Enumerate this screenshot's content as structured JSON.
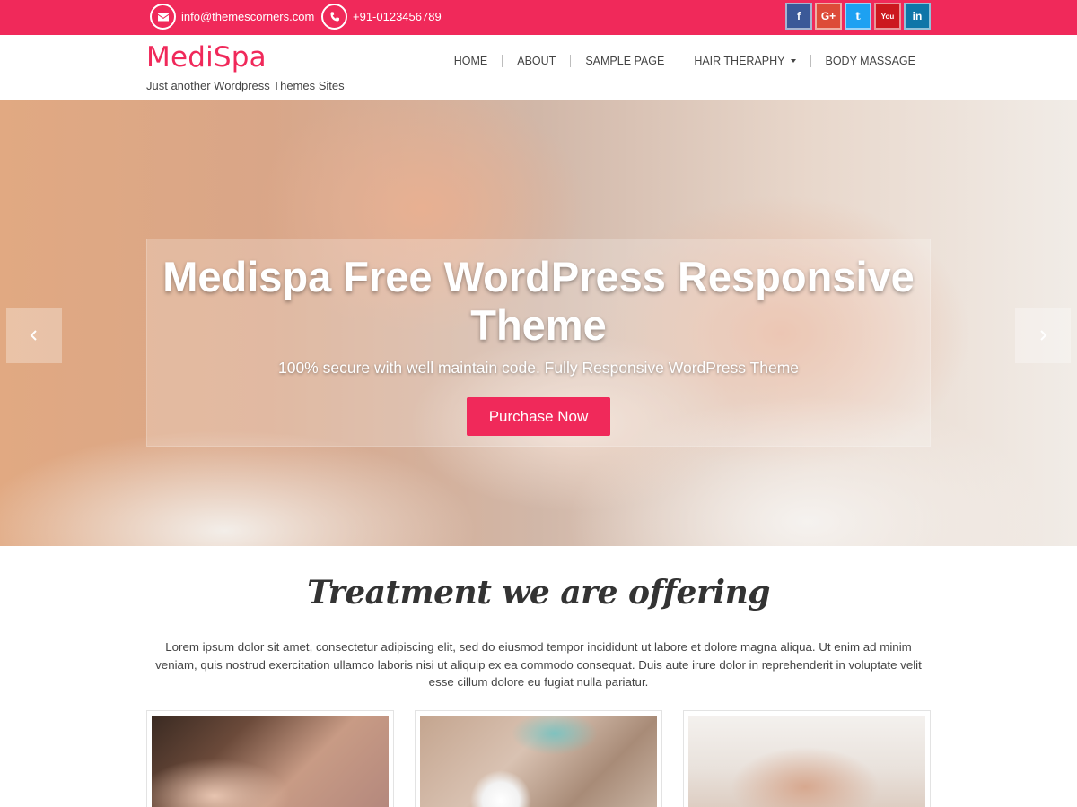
{
  "topbar": {
    "email": "info@themescorners.com",
    "phone": "+91-0123456789",
    "email_icon": "envelope-icon",
    "phone_icon": "phone-icon",
    "socials": [
      {
        "name": "facebook",
        "glyph": "f",
        "color": "#3b5998"
      },
      {
        "name": "google-plus",
        "glyph": "G+",
        "color": "#dd4b39"
      },
      {
        "name": "twitter",
        "glyph": "t",
        "color": "#1da1f2"
      },
      {
        "name": "youtube",
        "glyph": "You",
        "color": "#cc181e"
      },
      {
        "name": "linkedin",
        "glyph": "in",
        "color": "#0e76a8"
      }
    ],
    "background": "#f0295a"
  },
  "header": {
    "site_title": "MediSpa",
    "tagline": "Just another Wordpress Themes Sites",
    "nav": [
      "HOME",
      "ABOUT",
      "SAMPLE PAGE",
      "HAIR THERAPHY",
      "BODY MASSAGE"
    ]
  },
  "hero": {
    "title": "Medispa Free WordPress Responsive Theme",
    "subtitle": "100% secure with well maintain code. Fully Responsive WordPress Theme",
    "button": "Purchase Now",
    "prev_icon": "chevron-left-icon",
    "next_icon": "chevron-right-icon"
  },
  "treatments": {
    "title": "Treatment we are offering",
    "text": "Lorem ipsum dolor sit amet, consectetur adipiscing elit, sed do eiusmod tempor incididunt ut labore et dolore magna aliqua. Ut enim ad minim veniam, quis nostrud exercitation ullamco laboris nisi ut aliquip ex ea commodo consequat. Duis aute irure dolor in reprehenderit in voluptate velit esse cillum dolore eu fugiat nulla pariatur."
  },
  "colors": {
    "accent": "#f0295a",
    "text": "#444444"
  }
}
